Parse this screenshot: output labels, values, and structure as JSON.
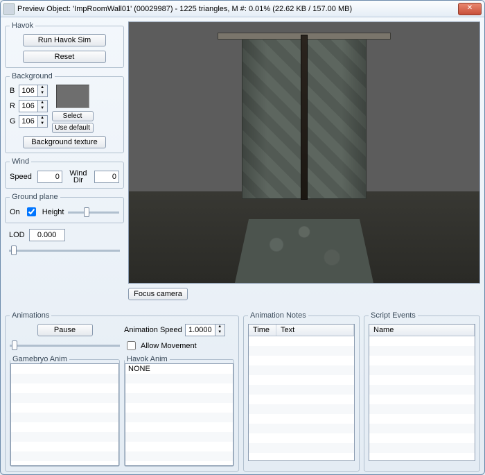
{
  "window": {
    "title": "Preview Object: 'ImpRoomWall01' (00029987) - 1225 triangles, M #: 0.01% (22.62 KB / 157.00 MB)"
  },
  "havok": {
    "legend": "Havok",
    "run": "Run Havok Sim",
    "reset": "Reset"
  },
  "background": {
    "legend": "Background",
    "b_label": "B",
    "r_label": "R",
    "g_label": "G",
    "b": "106",
    "r": "106",
    "g": "106",
    "select": "Select",
    "use_default": "Use default",
    "texture": "Background texture"
  },
  "wind": {
    "legend": "Wind",
    "speed_label": "Speed",
    "dir_label": "Wind Dir",
    "speed": "0",
    "dir": "0"
  },
  "ground": {
    "legend": "Ground plane",
    "on_label": "On",
    "on": true,
    "height_label": "Height"
  },
  "lod": {
    "label": "LOD",
    "value": "0.000"
  },
  "viewport": {
    "focus": "Focus camera"
  },
  "animations": {
    "legend": "Animations",
    "pause": "Pause",
    "speed_label": "Animation Speed",
    "speed": "1.0000",
    "allow_movement": "Allow Movement",
    "allow_movement_checked": false,
    "gamebryo_legend": "Gamebryo Anim",
    "havok_legend": "Havok Anim",
    "havok_none": "NONE"
  },
  "notes": {
    "legend": "Animation Notes",
    "col_time": "Time",
    "col_text": "Text"
  },
  "events": {
    "legend": "Script Events",
    "col_name": "Name"
  }
}
